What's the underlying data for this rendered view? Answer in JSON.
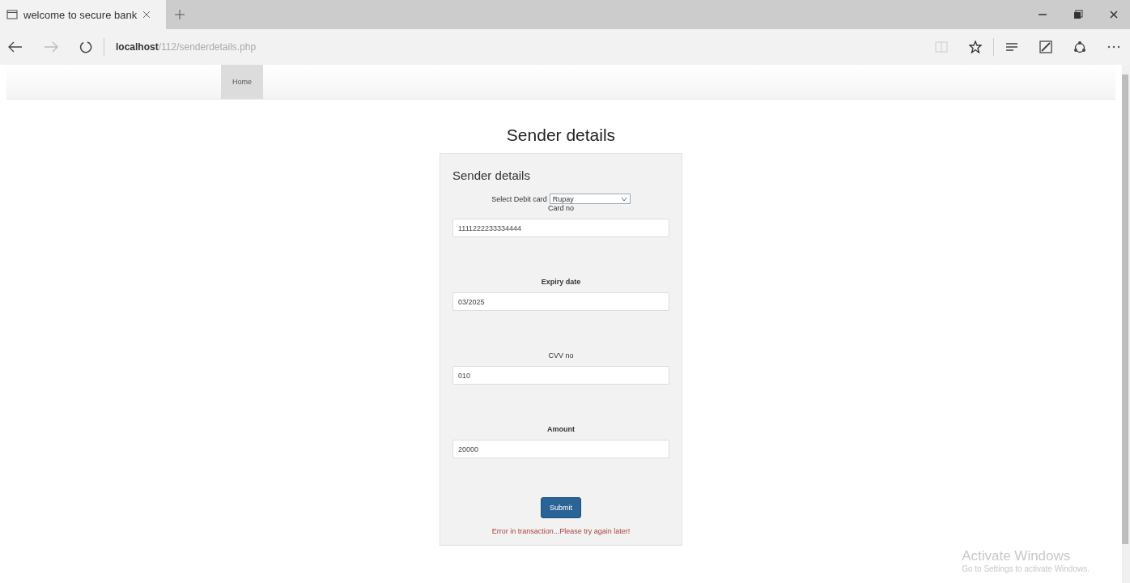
{
  "browser": {
    "tab_title": "welcome to secure bank",
    "url_host": "localhost",
    "url_path": "/112/senderdetails.php"
  },
  "nav": [
    {
      "label": "Home",
      "selected": true
    }
  ],
  "page_title": "Sender details",
  "form": {
    "heading": "Sender details",
    "card_select_label": "Select Debit card",
    "card_select_value": "Rupay",
    "fields": [
      {
        "label": "Card no",
        "value": "1111222233334444",
        "bold": false
      },
      {
        "label": "Expiry date",
        "value": "03/2025",
        "bold": true
      },
      {
        "label": "CVV no",
        "value": "010",
        "bold": false
      },
      {
        "label": "Amount",
        "value": "20000",
        "bold": true
      }
    ],
    "submit": "Submit",
    "error": "Error in transaction...Please try again later!"
  },
  "os_notice": {
    "title": "Activate Windows",
    "subtitle": "Go to Settings to activate Windows."
  }
}
